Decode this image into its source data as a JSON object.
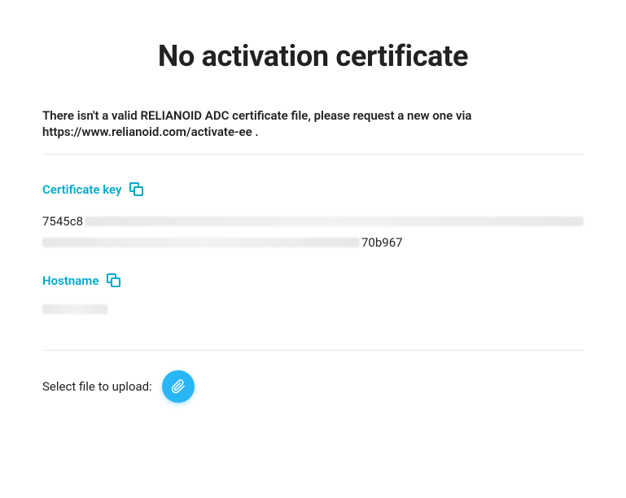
{
  "title": "No activation certificate",
  "message": "There isn't a valid RELIANOID ADC certificate file, please request a new one via https://www.relianoid.com/activate-ee .",
  "certKey": {
    "label": "Certificate key",
    "prefix": "7545c8",
    "suffix": "70b967"
  },
  "hostname": {
    "label": "Hostname"
  },
  "upload": {
    "label": "Select file to upload:"
  },
  "colors": {
    "accent": "#00a9cc",
    "button": "#29b6f6"
  }
}
